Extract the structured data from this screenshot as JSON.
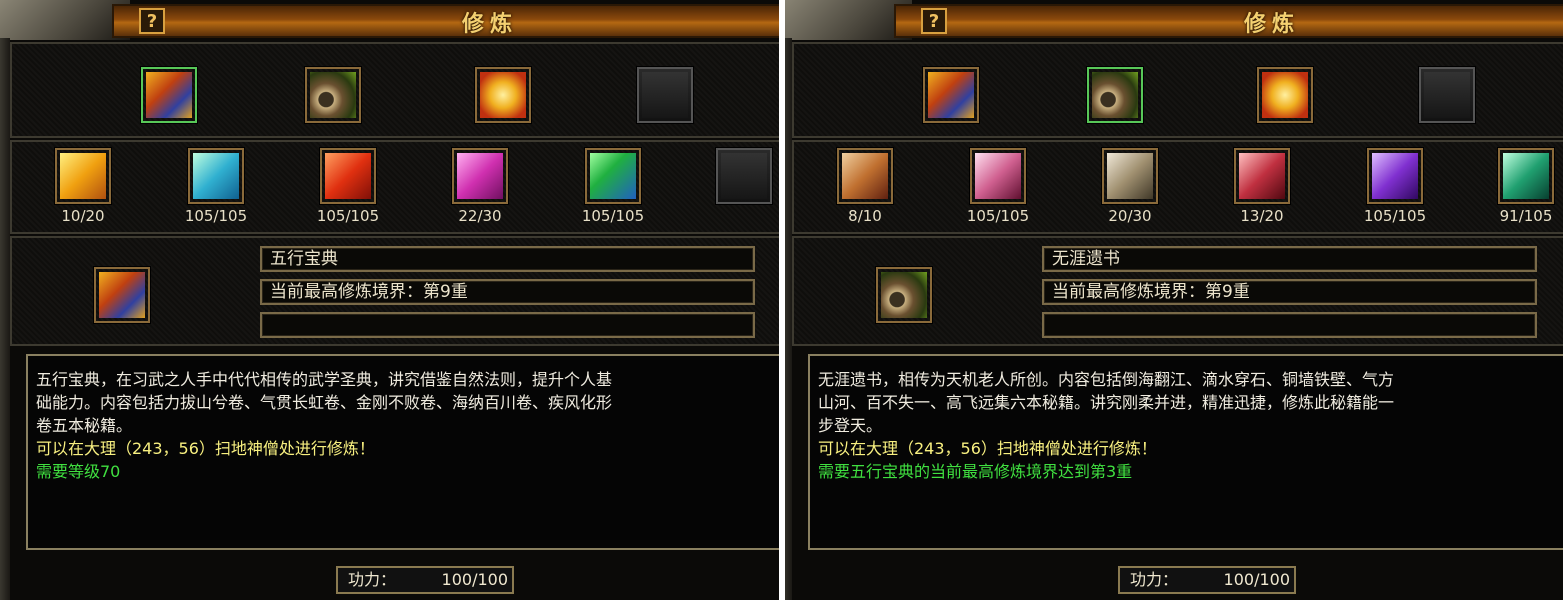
{
  "panels": [
    {
      "title": "修炼",
      "help_icon": "?",
      "top_slots": [
        {
          "icon": "book-icon",
          "selected": true
        },
        {
          "icon": "scroll-bundle-icon",
          "selected": false
        },
        {
          "icon": "gold-scroll-icon",
          "selected": false
        },
        {
          "icon": "empty-slot",
          "selected": false
        }
      ],
      "sub_slots": [
        {
          "icon": "yellow-book-icon",
          "count": "10/20"
        },
        {
          "icon": "cyan-book-icon",
          "count": "105/105"
        },
        {
          "icon": "red-book-icon",
          "count": "105/105"
        },
        {
          "icon": "pink-book-icon",
          "count": "22/30"
        },
        {
          "icon": "green-book-icon",
          "count": "105/105"
        },
        {
          "icon": "empty-slot",
          "count": ""
        }
      ],
      "book_name": "五行宝典",
      "realm": "当前最高修炼境界：第9重",
      "extra": "",
      "description": [
        "五行宝典，在习武之人手中代代相传的武学圣典，讲究借鉴自然法则，提升个人基",
        "础能力。内容包括力拔山兮卷、气贯长虹卷、金刚不败卷、海纳百川卷、疾风化形",
        "卷五本秘籍。"
      ],
      "location": "可以在大理（243，56）扫地神僧处进行修炼！",
      "requirement": "需要等级70",
      "power_label": "功力：",
      "power_value": "100/100"
    },
    {
      "title": "修炼",
      "help_icon": "?",
      "top_slots": [
        {
          "icon": "book-icon",
          "selected": false
        },
        {
          "icon": "scroll-bundle-icon",
          "selected": true
        },
        {
          "icon": "gold-scroll-icon",
          "selected": false
        },
        {
          "icon": "empty-slot",
          "selected": false
        }
      ],
      "sub_slots": [
        {
          "icon": "orange-scroll-icon",
          "count": "8/10"
        },
        {
          "icon": "pink-scroll-icon",
          "count": "105/105"
        },
        {
          "icon": "gray-scroll-icon",
          "count": "20/30"
        },
        {
          "icon": "red-scroll-icon",
          "count": "13/20"
        },
        {
          "icon": "purple-scroll-icon",
          "count": "105/105"
        },
        {
          "icon": "teal-scroll-icon",
          "count": "91/105"
        }
      ],
      "book_name": "无涯遗书",
      "realm": "当前最高修炼境界：第9重",
      "extra": "",
      "description": [
        "无涯遗书，相传为天机老人所创。内容包括倒海翻江、滴水穿石、铜墙铁壁、气方",
        "山河、百不失一、高飞远集六本秘籍。讲究刚柔并进，精准迅捷，修炼此秘籍能一",
        "步登天。"
      ],
      "location": "可以在大理（243，56）扫地神僧处进行修炼！",
      "requirement": "需要五行宝典的当前最高修炼境界达到第3重",
      "power_label": "功力：",
      "power_value": "100/100"
    }
  ],
  "colors": {
    "title": "#f4d070",
    "location_text": "#f8f080",
    "requirement_text": "#40e040",
    "selected_border": "#58c858"
  }
}
